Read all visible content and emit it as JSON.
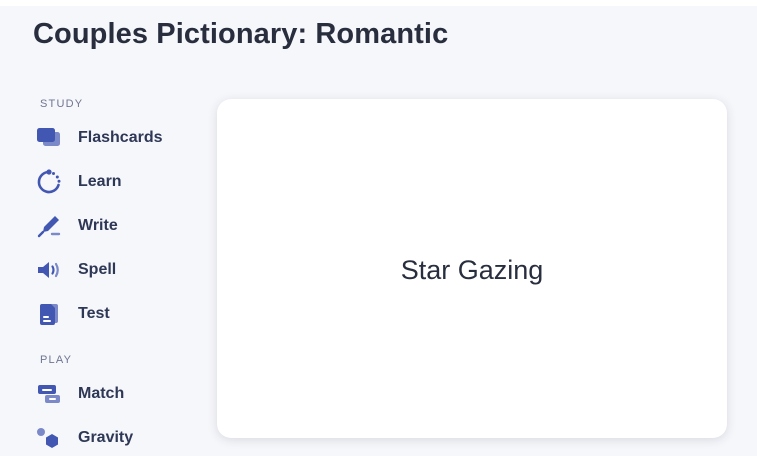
{
  "page": {
    "title": "Couples Pictionary: Romantic"
  },
  "sidebar": {
    "study_label": "STUDY",
    "play_label": "PLAY",
    "study_items": [
      {
        "label": "Flashcards",
        "icon": "flashcards-icon"
      },
      {
        "label": "Learn",
        "icon": "learn-icon"
      },
      {
        "label": "Write",
        "icon": "write-icon"
      },
      {
        "label": "Spell",
        "icon": "spell-icon"
      },
      {
        "label": "Test",
        "icon": "test-icon"
      }
    ],
    "play_items": [
      {
        "label": "Match",
        "icon": "match-icon"
      },
      {
        "label": "Gravity",
        "icon": "gravity-icon"
      }
    ]
  },
  "flashcard": {
    "term": "Star Gazing"
  },
  "colors": {
    "background": "#f6f7fb",
    "card": "#ffffff",
    "icon_primary": "#4257b2",
    "icon_secondary": "#7b89c9",
    "text": "#2e3856"
  }
}
